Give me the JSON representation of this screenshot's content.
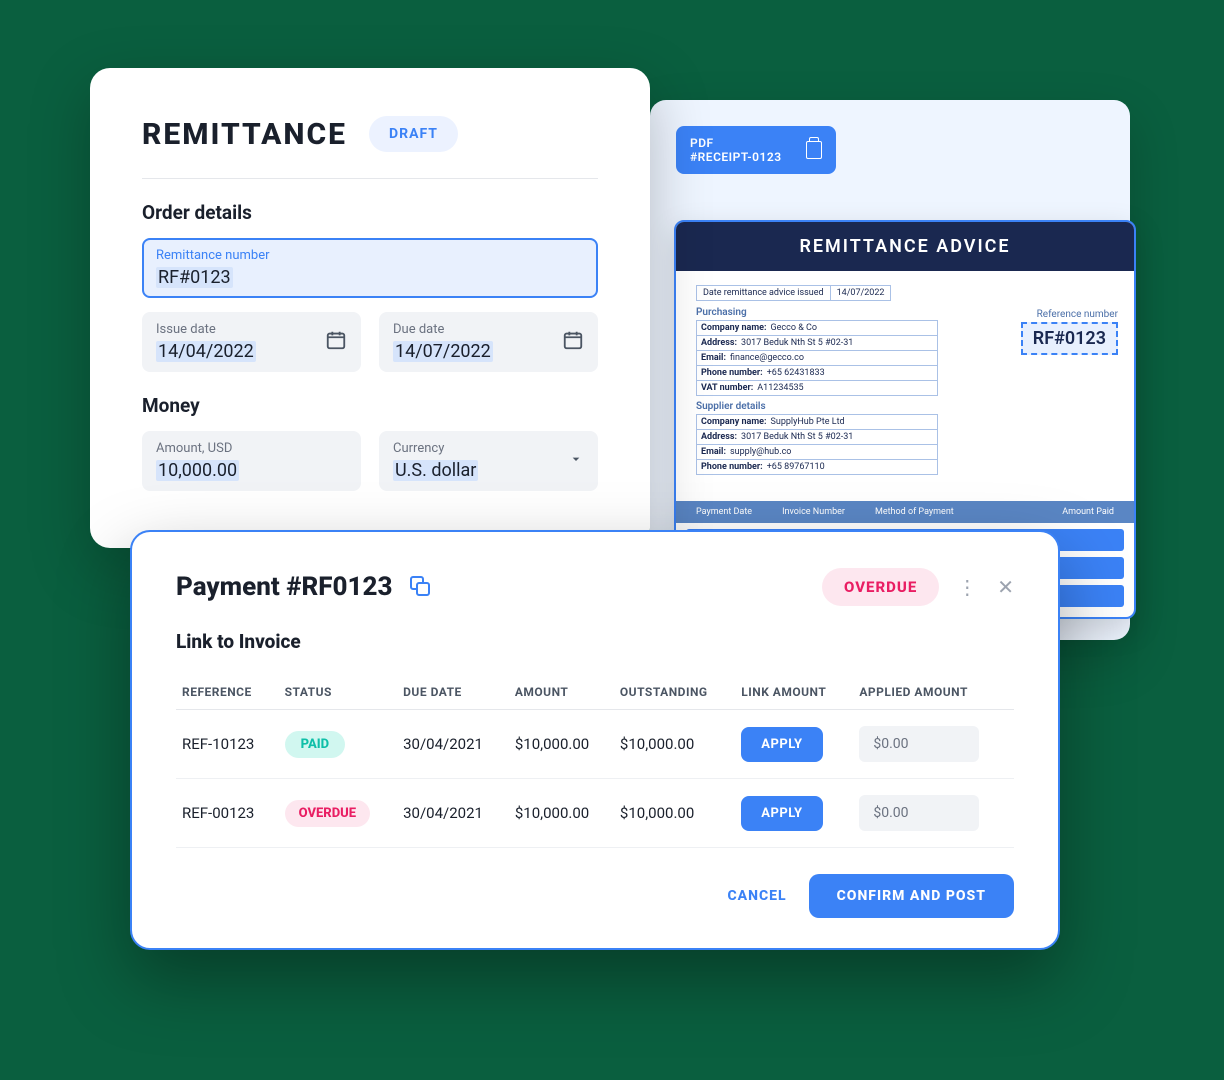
{
  "remittance": {
    "title": "REMITTANCE",
    "status": "DRAFT",
    "order_details_label": "Order details",
    "remittance_number": {
      "label": "Remittance number",
      "value": "RF#0123"
    },
    "issue_date": {
      "label": "Issue date",
      "value": "14/04/2022"
    },
    "due_date": {
      "label": "Due date",
      "value": "14/07/2022"
    },
    "money_label": "Money",
    "amount": {
      "label": "Amount, USD",
      "value": "10,000.00"
    },
    "currency": {
      "label": "Currency",
      "value": "U.S. dollar"
    }
  },
  "pdf": {
    "chip_line1": "PDF",
    "chip_line2": "#RECEIPT-0123",
    "doc_title": "REMITTANCE ADVICE",
    "issued_label": "Date remittance advice issued",
    "issued_value": "14/07/2022",
    "reference_label": "Reference number",
    "reference_value": "RF#0123",
    "purchasing": {
      "heading": "Purchasing",
      "company_label": "Company name:",
      "company": "Gecco & Co",
      "address_label": "Address:",
      "address": "3017 Beduk Nth St 5 #02-31",
      "email_label": "Email:",
      "email": "finance@gecco.co",
      "phone_label": "Phone number:",
      "phone": "+65 62431833",
      "vat_label": "VAT number:",
      "vat": "A11234535"
    },
    "supplier": {
      "heading": "Supplier details",
      "company_label": "Company name:",
      "company": "SupplyHub Pte Ltd",
      "address_label": "Address:",
      "address": "3017 Beduk Nth St 5 #02-31",
      "email_label": "Email:",
      "email": "supply@hub.co",
      "phone_label": "Phone number:",
      "phone": "+65 89767110"
    },
    "columns": {
      "c1": "Payment Date",
      "c2": "Invoice Number",
      "c3": "Method of Payment",
      "c4": "Amount Paid"
    }
  },
  "payment": {
    "title": "Payment #RF0123",
    "status": "OVERDUE",
    "link_title": "Link to Invoice",
    "columns": {
      "reference": "REFERENCE",
      "status": "STATUS",
      "due": "DUE DATE",
      "amount": "AMOUNT",
      "outstanding": "OUTSTANDING",
      "link_amount": "LINK AMOUNT",
      "applied": "APPLIED AMOUNT"
    },
    "rows": [
      {
        "reference": "REF-10123",
        "status": "PAID",
        "due": "30/04/2021",
        "amount": "$10,000.00",
        "outstanding": "$10,000.00",
        "apply_label": "APPLY",
        "applied": "$0.00"
      },
      {
        "reference": "REF-00123",
        "status": "OVERDUE",
        "due": "30/04/2021",
        "amount": "$10,000.00",
        "outstanding": "$10,000.00",
        "apply_label": "APPLY",
        "applied": "$0.00"
      }
    ],
    "actions": {
      "cancel": "CANCEL",
      "confirm": "CONFIRM AND POST"
    }
  }
}
